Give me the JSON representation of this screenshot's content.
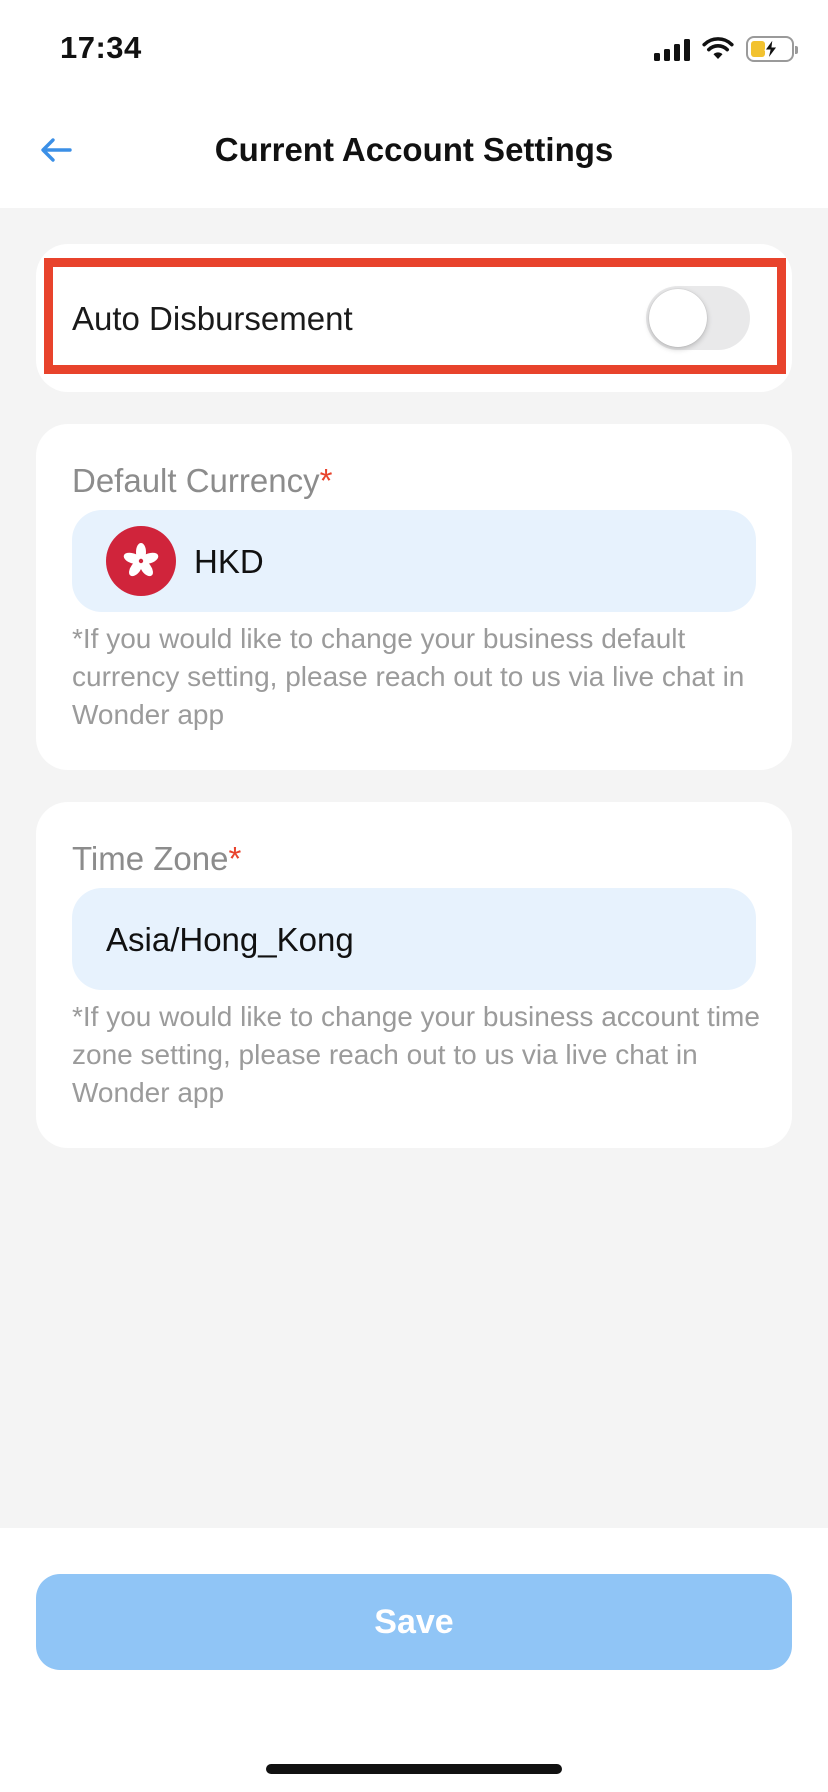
{
  "status_bar": {
    "time": "17:34",
    "icons": [
      "signal-icon",
      "wifi-icon",
      "battery-charging-icon"
    ]
  },
  "header": {
    "title": "Current Account Settings",
    "back_icon": "back-arrow-icon"
  },
  "auto_disbursement": {
    "label": "Auto Disbursement",
    "enabled": false
  },
  "default_currency": {
    "label": "Default Currency",
    "required_mark": "*",
    "value": "HKD",
    "flag_icon": "hong-kong-flag-icon",
    "note": "*If you would like to change your business default currency setting, please reach out to us via live chat in Wonder app"
  },
  "time_zone": {
    "label": "Time Zone",
    "required_mark": "*",
    "value": "Asia/Hong_Kong",
    "note": "*If you would like to change your business account time zone setting, please reach out to us via live chat in Wonder app"
  },
  "footer": {
    "save_label": "Save"
  },
  "colors": {
    "accent": "#3b8fe6",
    "highlight": "#e8432c",
    "save_button": "#90c5f6",
    "field_background": "#e7f2fd"
  }
}
